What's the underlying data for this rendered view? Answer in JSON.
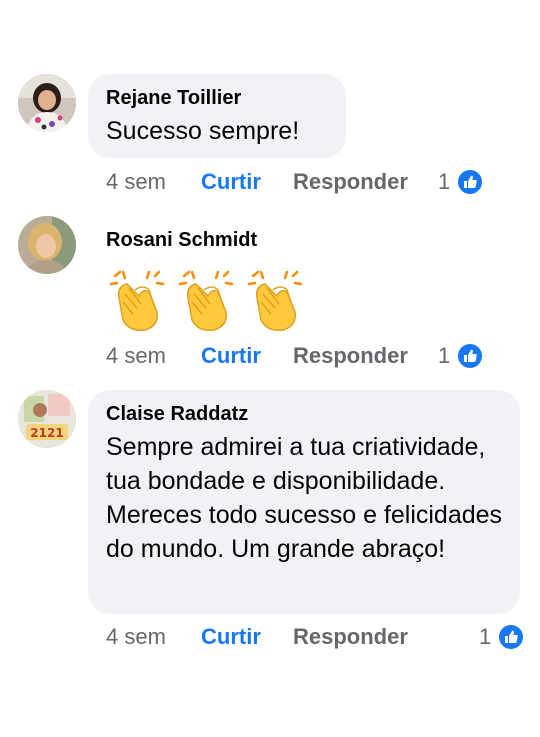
{
  "comments": [
    {
      "author": "Rejane Toillier",
      "text": "Sucesso sempre!",
      "time": "4 sem",
      "like_label": "Curtir",
      "reply_label": "Responder",
      "reactions": "1"
    },
    {
      "author": "Rosani Schmidt",
      "text": "",
      "emojis": [
        "clapping-hands",
        "clapping-hands",
        "clapping-hands"
      ],
      "time": "4 sem",
      "like_label": "Curtir",
      "reply_label": "Responder",
      "reactions": "1"
    },
    {
      "author": "Claise Raddatz",
      "text": "Sempre admirei a tua criatividade, tua bondade e disponibilidade. Mereces todo sucesso e felicidades do mundo. Um grande abraço!",
      "time": "4 sem",
      "like_label": "Curtir",
      "reply_label": "Responder",
      "reactions": "1"
    }
  ],
  "colors": {
    "bubble": "#f0f2f5",
    "accent": "#1877f2",
    "meta": "#65676b",
    "text": "#050505"
  },
  "icons": {
    "reaction": "thumbs-up-icon"
  }
}
